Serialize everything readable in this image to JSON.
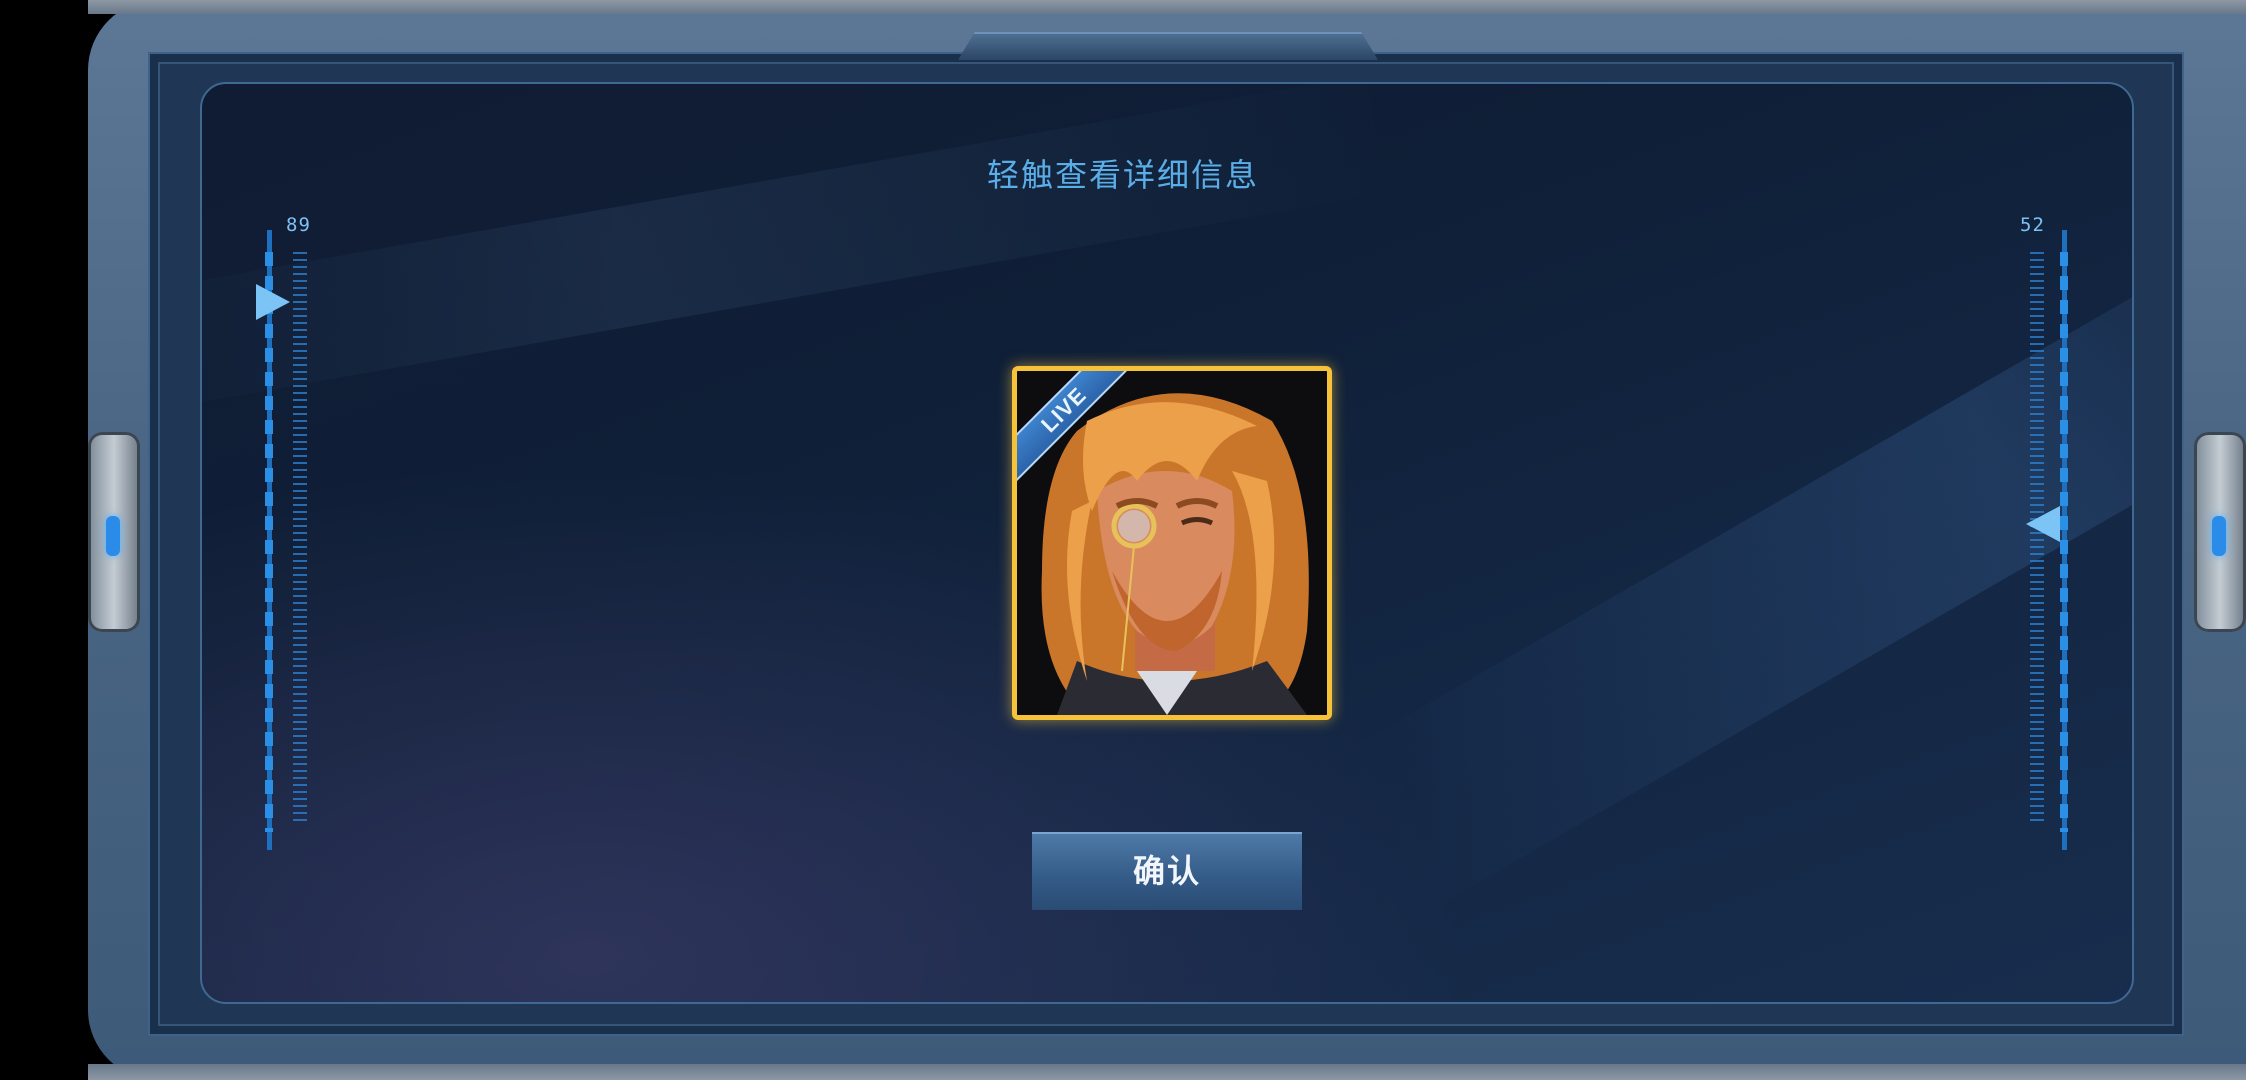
{
  "dialog": {
    "title": "轻触查看详细信息",
    "confirm_label": "确认"
  },
  "gauges": {
    "left_value": "89",
    "right_value": "52"
  },
  "card": {
    "badge": "LIVE",
    "frame_color": "#f5c23a",
    "character_hair_color": "#e6953a"
  },
  "colors": {
    "accent": "#5aaee8",
    "panel_background": "#12223d"
  }
}
